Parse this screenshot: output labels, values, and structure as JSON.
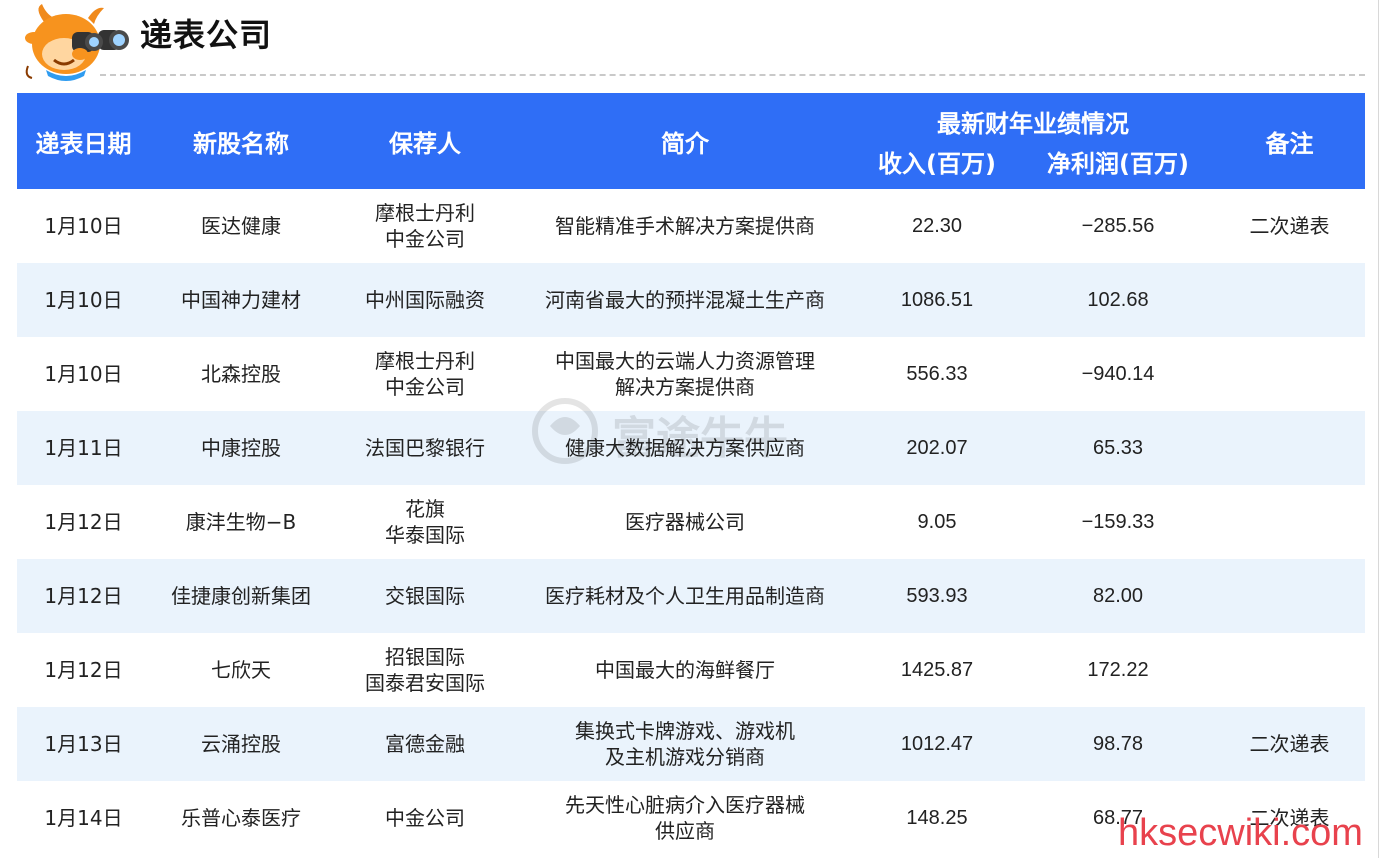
{
  "header": {
    "title": "递表公司"
  },
  "columns": {
    "date": "递表日期",
    "name": "新股名称",
    "sponsor": "保荐人",
    "intro": "简介",
    "group": "最新财年业绩情况",
    "revenue": "收入(百万)",
    "profit": "净利润(百万)",
    "note": "备注"
  },
  "rows": [
    {
      "date": "1月10日",
      "name": "医达健康",
      "sponsor": [
        "摩根士丹利",
        "中金公司"
      ],
      "intro": [
        "智能精准手术解决方案提供商"
      ],
      "revenue": "22.30",
      "profit": "−285.56",
      "note": "二次递表"
    },
    {
      "date": "1月10日",
      "name": "中国神力建材",
      "sponsor": [
        "中州国际融资"
      ],
      "intro": [
        "河南省最大的预拌混凝土生产商"
      ],
      "revenue": "1086.51",
      "profit": "102.68",
      "note": ""
    },
    {
      "date": "1月10日",
      "name": "北森控股",
      "sponsor": [
        "摩根士丹利",
        "中金公司"
      ],
      "intro": [
        "中国最大的云端人力资源管理",
        "解决方案提供商"
      ],
      "revenue": "556.33",
      "profit": "−940.14",
      "note": ""
    },
    {
      "date": "1月11日",
      "name": "中康控股",
      "sponsor": [
        "法国巴黎银行"
      ],
      "intro": [
        "健康大数据解决方案供应商"
      ],
      "revenue": "202.07",
      "profit": "65.33",
      "note": ""
    },
    {
      "date": "1月12日",
      "name": "康沣生物−B",
      "sponsor": [
        "花旗",
        "华泰国际"
      ],
      "intro": [
        "医疗器械公司"
      ],
      "revenue": "9.05",
      "profit": "−159.33",
      "note": ""
    },
    {
      "date": "1月12日",
      "name": "佳捷康创新集团",
      "sponsor": [
        "交银国际"
      ],
      "intro": [
        "医疗耗材及个人卫生用品制造商"
      ],
      "revenue": "593.93",
      "profit": "82.00",
      "note": ""
    },
    {
      "date": "1月12日",
      "name": "七欣天",
      "sponsor": [
        "招银国际",
        "国泰君安国际"
      ],
      "intro": [
        "中国最大的海鲜餐厅"
      ],
      "revenue": "1425.87",
      "profit": "172.22",
      "note": ""
    },
    {
      "date": "1月13日",
      "name": "云涌控股",
      "sponsor": [
        "富德金融"
      ],
      "intro": [
        "集换式卡牌游戏、游戏机",
        "及主机游戏分销商"
      ],
      "revenue": "1012.47",
      "profit": "98.78",
      "note": "二次递表"
    },
    {
      "date": "1月14日",
      "name": "乐普心泰医疗",
      "sponsor": [
        "中金公司"
      ],
      "intro": [
        "先天性心脏病介入医疗器械",
        "供应商"
      ],
      "revenue": "148.25",
      "profit": "68.77",
      "note": "二次递表"
    }
  ],
  "watermark": {
    "text": "富途牛牛"
  },
  "site_mark": {
    "text": "hksecwiki.com"
  },
  "colors": {
    "header_bg": "#2f6ef6",
    "stripe": "#eaf3fc",
    "site_mark": "#e8424d"
  }
}
